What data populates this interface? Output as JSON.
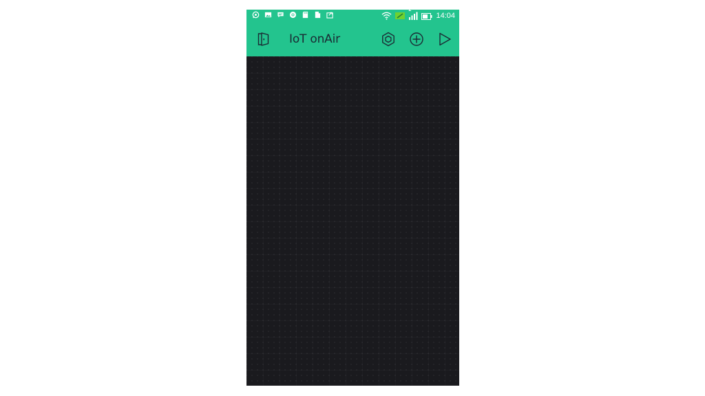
{
  "status_bar": {
    "time": "14:04",
    "notification_icons": [
      "whatsapp-icon",
      "image-icon",
      "chat-icon",
      "chrome-icon",
      "sd-card-icon",
      "file-icon",
      "photo-share-icon"
    ],
    "system_icons": [
      "wifi-icon",
      "data-saver-icon",
      "signal-icon",
      "battery-icon"
    ],
    "sim_slot": "2"
  },
  "app_bar": {
    "title": "IoT onAir",
    "background_color": "#23c48e",
    "actions": [
      "exit-icon",
      "settings-hexagon-icon",
      "add-widget-icon",
      "play-icon"
    ]
  },
  "canvas": {
    "background_color": "#1a1a1e"
  }
}
